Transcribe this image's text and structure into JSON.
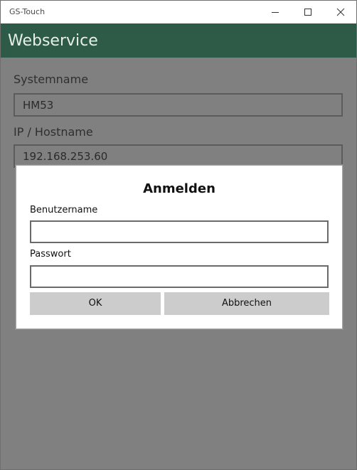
{
  "window": {
    "title": "GS-Touch",
    "controls": {
      "minimize_icon": "minimize-icon",
      "maximize_icon": "maximize-icon",
      "close_icon": "close-icon"
    }
  },
  "header": {
    "title": "Webservice"
  },
  "form": {
    "systemname_label": "Systemname",
    "systemname_value": "HM53",
    "host_label": "IP / Hostname",
    "host_value": "192.168.253.60"
  },
  "dialog": {
    "title": "Anmelden",
    "username_label": "Benutzername",
    "username_value": "",
    "password_label": "Passwort",
    "password_value": "",
    "ok_label": "OK",
    "cancel_label": "Abbrechen"
  },
  "colors": {
    "header_bg": "#2e5b47",
    "overlay_bg": "#808080",
    "button_bg": "#cccccc"
  }
}
